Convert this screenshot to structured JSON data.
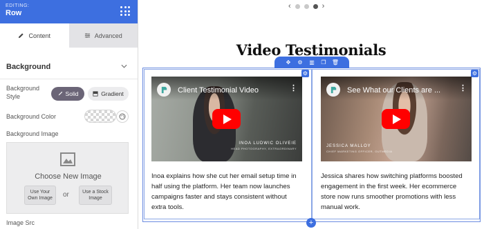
{
  "sidebar": {
    "editing_label": "EDITING:",
    "title": "Row",
    "tabs": [
      {
        "label": "Content",
        "icon": "pencil-icon",
        "active": true
      },
      {
        "label": "Advanced",
        "icon": "sliders-icon",
        "active": false
      }
    ],
    "section_title": "Background",
    "background_style": {
      "label": "Background Style",
      "options": [
        "Solid",
        "Gradient"
      ],
      "selected": "Solid"
    },
    "background_color_label": "Background Color",
    "background_image": {
      "label": "Background Image",
      "choose_label": "Choose New Image",
      "own_image_label": "Use Your Own Image",
      "or_label": "or",
      "stock_image_label": "Use a Stock Image"
    },
    "image_src_label": "Image Src",
    "collapse_glyph": "‹"
  },
  "canvas": {
    "carousel": {
      "prev": "‹",
      "next": "›",
      "dots": 3,
      "active_index": 2
    },
    "heading": "Video Testimonials",
    "videos": [
      {
        "title": "Client Testimonial Video",
        "caption_name": "INOA LUDWIC OLIVEIE",
        "caption_sub": "HEAD PHOTOGRAPHY, EXTRAORDINARY",
        "description": "Inoa explains how she cut her email setup time in half using the platform. Her team now launches campaigns faster and stays consistent without extra tools."
      },
      {
        "title": "See What our Clients are ...",
        "caption_name": "JESSICA MALLOY",
        "caption_sub": "CHIEF MARKETING OFFICER, OUTMEDIA",
        "description": "Jessica shares how switching platforms boosted engagement in the first week. Her ecommerce store now runs smoother promotions with less manual work."
      }
    ]
  },
  "colors": {
    "accent": "#3d6fe0",
    "solid_button": "#6b6577",
    "play_button": "#ff0000"
  }
}
